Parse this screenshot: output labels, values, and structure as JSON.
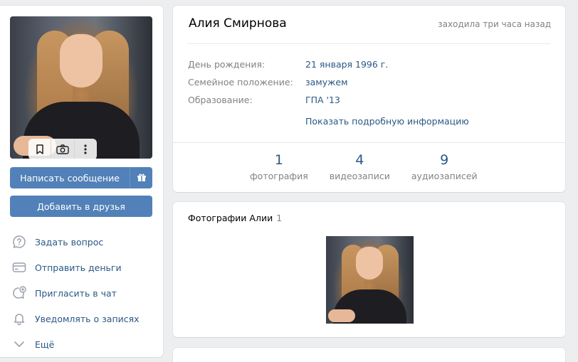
{
  "profile": {
    "name": "Алия Смирнова",
    "last_seen": "заходила три часа назад",
    "info": [
      {
        "key": "День рождения:",
        "value": "21 января 1996 г."
      },
      {
        "key": "Семейное положение:",
        "value": "замужем"
      },
      {
        "key": "Образование:",
        "value": "ГПА '13"
      }
    ],
    "show_more": "Показать подробную информацию",
    "counters": [
      {
        "num": "1",
        "label": "фотография"
      },
      {
        "num": "4",
        "label": "видеозаписи"
      },
      {
        "num": "9",
        "label": "аудиозаписей"
      }
    ]
  },
  "actions": {
    "message": "Написать сообщение",
    "add_friend": "Добавить в друзья"
  },
  "menu": [
    {
      "label": "Задать вопрос",
      "icon": "question-bubble-icon"
    },
    {
      "label": "Отправить деньги",
      "icon": "card-icon"
    },
    {
      "label": "Пригласить в чат",
      "icon": "chat-plus-icon"
    },
    {
      "label": "Уведомлять о записях",
      "icon": "bell-icon"
    },
    {
      "label": "Ещё",
      "icon": "chevron-down-icon"
    }
  ],
  "photos": {
    "title": "Фотографии Алии",
    "count": "1"
  },
  "colors": {
    "accent": "#5181b8",
    "link": "#2a5885",
    "muted": "#828282",
    "background": "#edeef0"
  }
}
